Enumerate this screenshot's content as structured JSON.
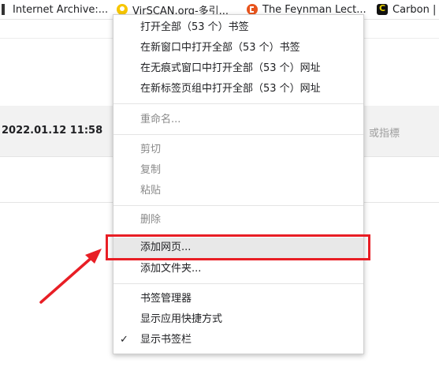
{
  "bookmarks_bar": {
    "items": [
      {
        "label": "Internet Archive:...",
        "icon": "archive-icon"
      },
      {
        "label": "VirSCAN.org-多引...",
        "icon": "virscan-icon"
      },
      {
        "label": "The Feynman Lect...",
        "icon": "feynman-icon"
      },
      {
        "label": "Carbon |",
        "icon": "carbon-icon"
      }
    ]
  },
  "background": {
    "row_date": "2022.01.12 11:58",
    "row_right_text": "或指標"
  },
  "context_menu": {
    "open_all": "打开全部（53 个）书签",
    "open_all_new_window": "在新窗口中打开全部（53 个）书签",
    "open_all_incognito": "在无痕式窗口中打开全部（53 个）网址",
    "open_all_tab_group": "在新标签页组中打开全部（53 个）网址",
    "rename": "重命名...",
    "cut": "剪切",
    "copy": "复制",
    "paste": "粘贴",
    "delete": "删除",
    "add_page": "添加网页...",
    "add_folder": "添加文件夹...",
    "bookmark_manager": "书签管理器",
    "show_apps_shortcut": "显示应用快捷方式",
    "show_bookmarks_bar": "显示书签栏",
    "checkmark": "✓"
  },
  "colors": {
    "annotation_red": "#e81e25",
    "hover_gray": "#e8e8e8",
    "disabled_text": "#8a8a8a"
  }
}
